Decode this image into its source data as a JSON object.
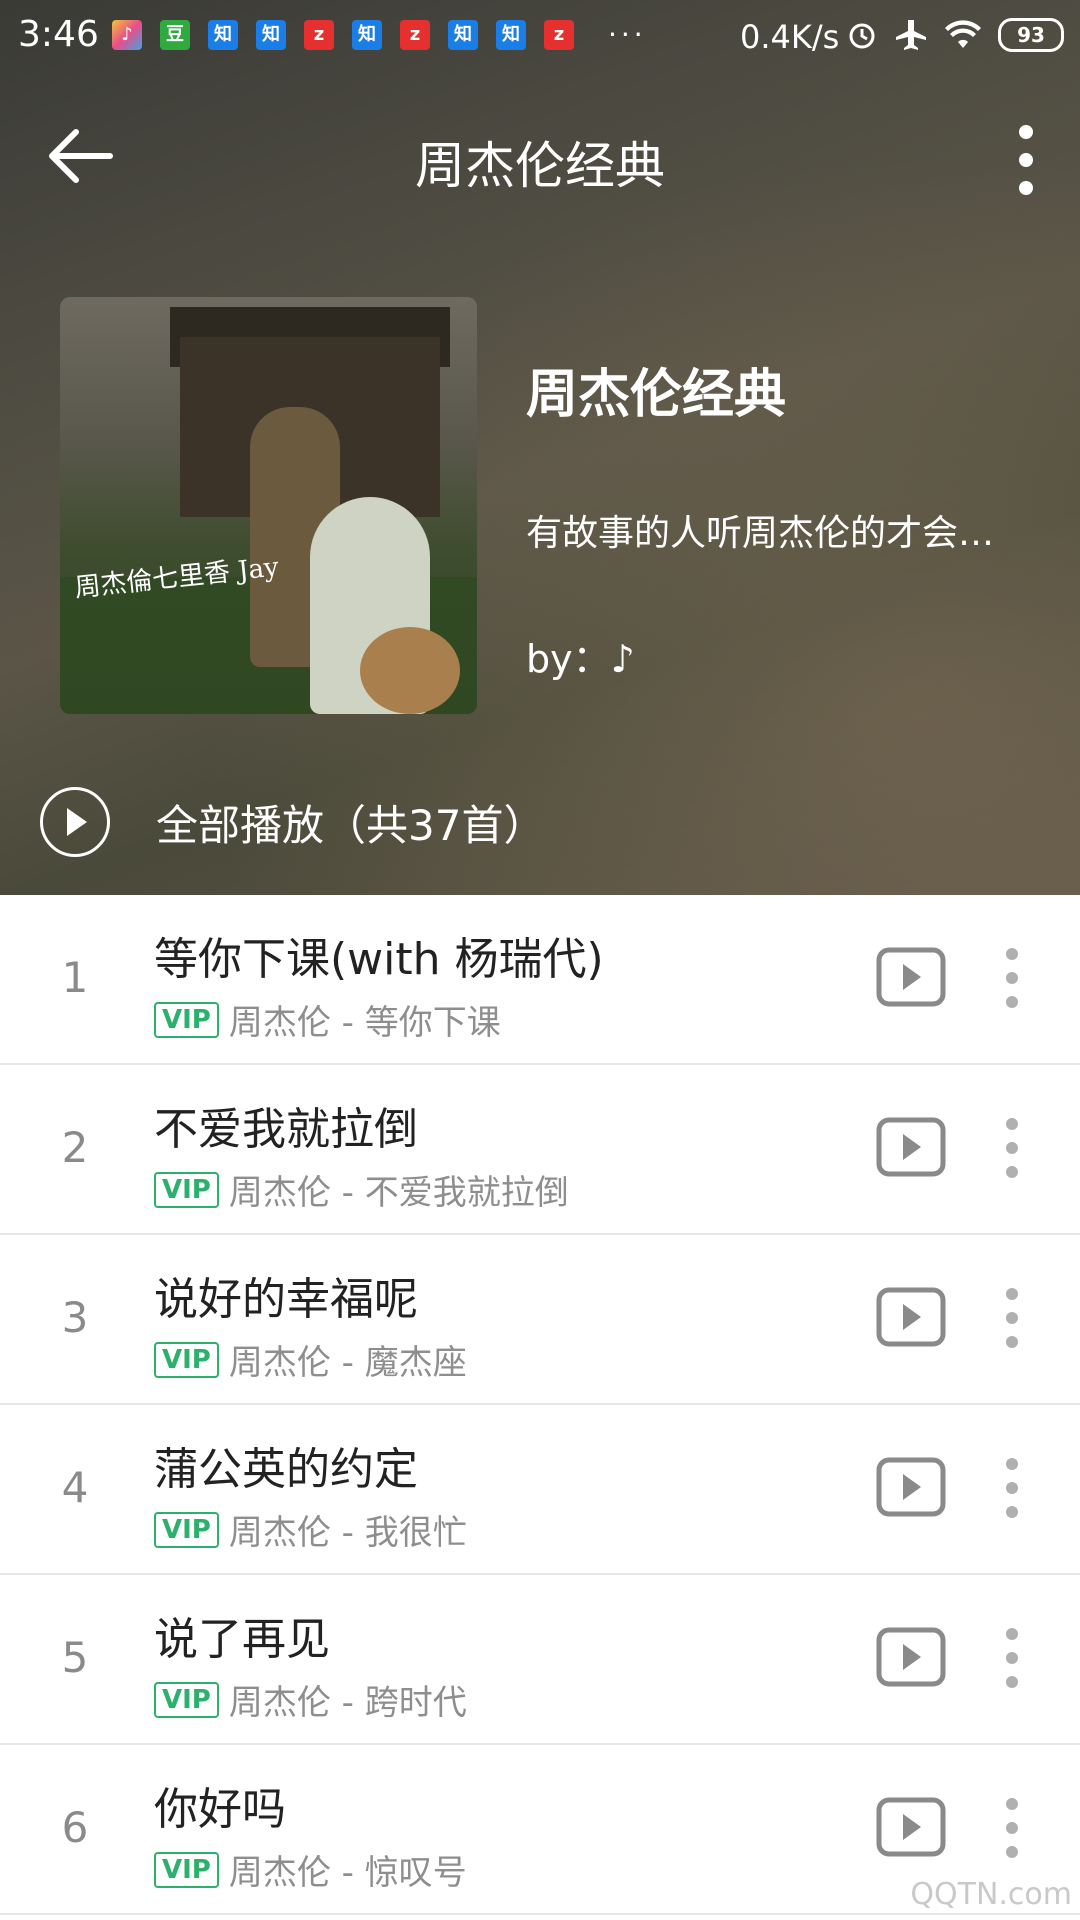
{
  "status_bar": {
    "time": "3:46",
    "notifications": [
      {
        "label": "豆",
        "color": "#2eaa3f"
      },
      {
        "label": "知",
        "color": "#1a7ee6"
      },
      {
        "label": "知",
        "color": "#1a7ee6"
      },
      {
        "label": "z",
        "color": "#e63030"
      },
      {
        "label": "知",
        "color": "#1a7ee6"
      },
      {
        "label": "z",
        "color": "#e63030"
      },
      {
        "label": "知",
        "color": "#1a7ee6"
      },
      {
        "label": "知",
        "color": "#1a7ee6"
      },
      {
        "label": "z",
        "color": "#e63030"
      }
    ],
    "more": "···",
    "speed": "0.4K/s",
    "battery": "93"
  },
  "appbar": {
    "title": "周杰伦经典"
  },
  "playlist": {
    "title": "周杰伦经典",
    "description": "有故事的人听周杰伦的才会…",
    "by": "by：♪",
    "cover_text": "周杰倫七里香 Jay"
  },
  "play_all": {
    "label": "全部播放（共37首）"
  },
  "songs": [
    {
      "index": "1",
      "title": "等你下课(with 杨瑞代)",
      "badge": "VIP",
      "artist": "周杰伦 - 等你下课"
    },
    {
      "index": "2",
      "title": "不爱我就拉倒",
      "badge": "VIP",
      "artist": "周杰伦 - 不爱我就拉倒"
    },
    {
      "index": "3",
      "title": "说好的幸福呢",
      "badge": "VIP",
      "artist": "周杰伦 - 魔杰座"
    },
    {
      "index": "4",
      "title": "蒲公英的约定",
      "badge": "VIP",
      "artist": "周杰伦 - 我很忙"
    },
    {
      "index": "5",
      "title": "说了再见",
      "badge": "VIP",
      "artist": "周杰伦 - 跨时代"
    },
    {
      "index": "6",
      "title": "你好吗",
      "badge": "VIP",
      "artist": "周杰伦 - 惊叹号"
    }
  ],
  "watermark": "QQTN.com",
  "colors": {
    "vip": "#2bb16b",
    "text_secondary": "#8e8e8e"
  }
}
